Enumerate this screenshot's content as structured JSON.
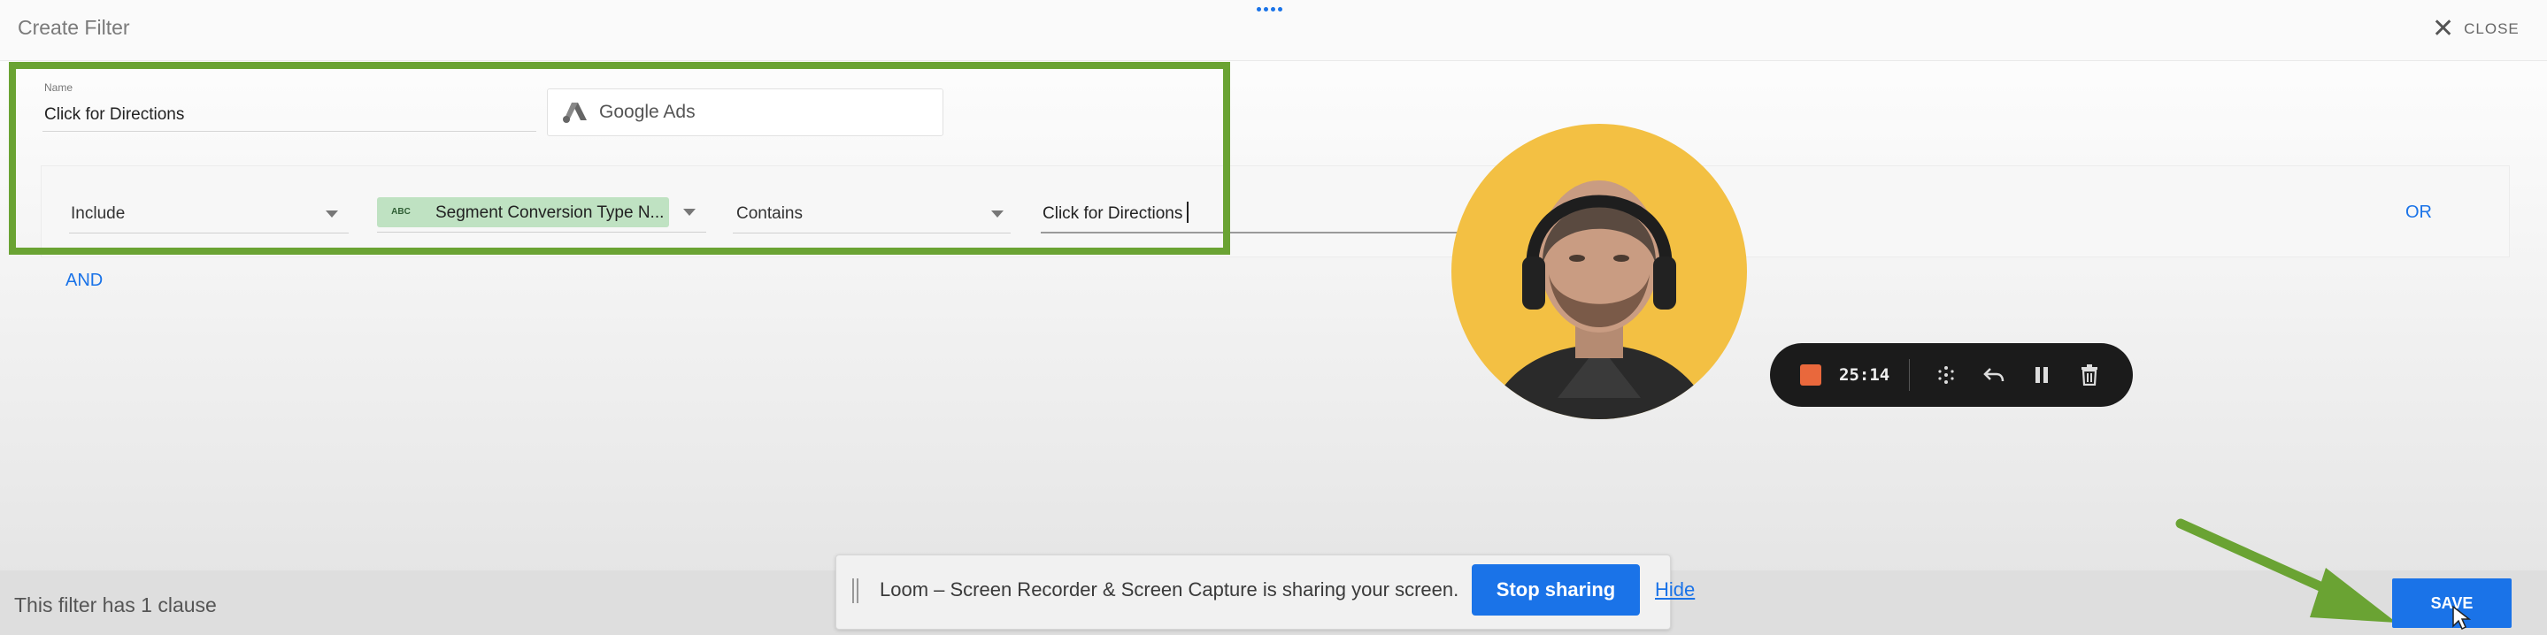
{
  "dialog": {
    "title": "Create Filter",
    "close_label": "CLOSE",
    "name_label": "Name",
    "name_value": "Click for Directions",
    "data_source": "Google Ads"
  },
  "clause": {
    "condition": "Include",
    "field_badge": "ABC",
    "field_name": "Segment Conversion Type N...",
    "operator": "Contains",
    "value": "Click for Directions",
    "or_label": "OR"
  },
  "and_label": "AND",
  "footer": {
    "clause_count_text": "This filter has 1 clause",
    "save_label": "SAVE"
  },
  "loom": {
    "share_text": "Loom – Screen Recorder & Screen Capture is sharing your screen.",
    "stop_label": "Stop sharing",
    "hide_label": "Hide",
    "timer": "25:14"
  },
  "colors": {
    "accent": "#1a73e8",
    "highlight_box": "#6aa333",
    "field_chip": "#bfe2c2",
    "record_dot": "#e9683c",
    "avatar_bg": "#f3c043"
  },
  "icons": [
    "close-icon",
    "google-ads-icon",
    "dropdown-caret-icon",
    "stop-record-icon",
    "grid-icon",
    "undo-icon",
    "pause-icon",
    "trash-icon",
    "drag-grip-icon",
    "green-arrow-icon",
    "mouse-cursor-icon"
  ]
}
